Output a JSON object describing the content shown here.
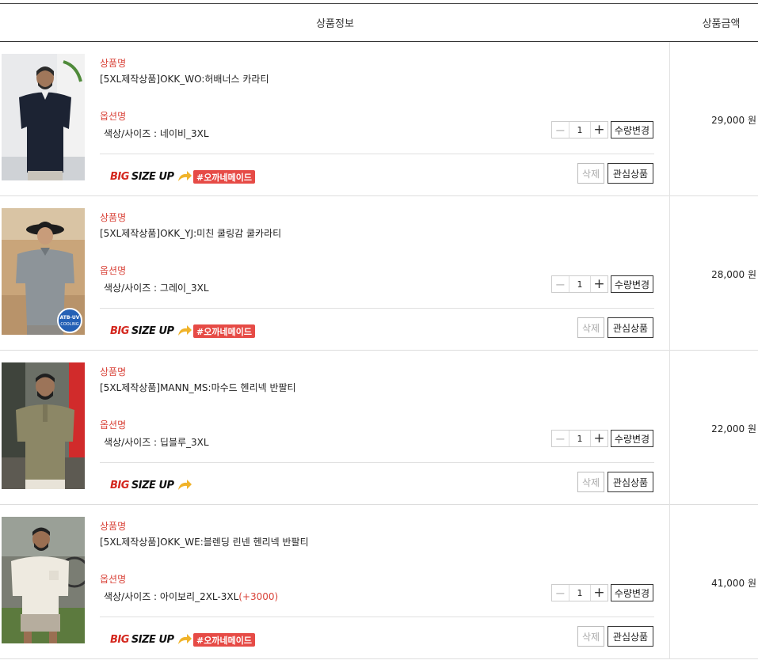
{
  "header": {
    "info_label": "상품정보",
    "price_label": "상품금액"
  },
  "labels": {
    "product_name": "상품명",
    "option_name": "옵션명"
  },
  "buttons": {
    "change_qty": "수량변경",
    "delete": "삭제",
    "wishlist": "관심상품"
  },
  "badge": {
    "big": "BIG",
    "size_up": "SIZE UP"
  },
  "colors": {
    "accent_red": "#d9443a",
    "tag_bg": "#e64b46"
  },
  "items": [
    {
      "name": "[5XL제작상품]OKK_WO:허배너스 카라티",
      "option": "색상/사이즈 : 네이비_3XL",
      "option_extra": "",
      "qty": "1",
      "price": "29,000 원",
      "tag": "#오까네메이드"
    },
    {
      "name": "[5XL제작상품]OKK_YJ:미친 쿨링감 쿨카라티",
      "option": "색상/사이즈 : 그레이_3XL",
      "option_extra": "",
      "qty": "1",
      "price": "28,000 원",
      "tag": "#오까네메이드",
      "image_text": "ATB-UV COOLING"
    },
    {
      "name": "[5XL제작상품]MANN_MS:마수드 헨리넥 반팔티",
      "option": "색상/사이즈 : 딥블루_3XL",
      "option_extra": "",
      "qty": "1",
      "price": "22,000 원",
      "tag": ""
    },
    {
      "name": "[5XL제작상품]OKK_WE:블렌딩 린넨 헨리넥 반팔티",
      "option": "색상/사이즈 : 아이보리_2XL-3XL",
      "option_extra": "(+3000)",
      "qty": "1",
      "price": "41,000 원",
      "tag": "#오까네메이드"
    }
  ]
}
